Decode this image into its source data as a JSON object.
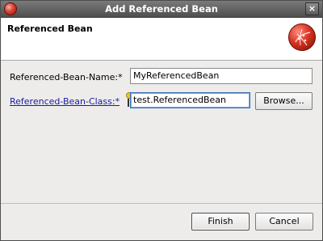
{
  "window": {
    "title": "Add Referenced Bean",
    "close_glyph": "×"
  },
  "banner": {
    "title": "Referenced Bean",
    "icon": "red-sphere-icon"
  },
  "form": {
    "name_label": "Referenced-Bean-Name:*",
    "name_value": "MyReferencedBean",
    "class_label": "Referenced-Bean-Class:*",
    "class_value": "test.ReferencedBean",
    "browse_label": "Browse..."
  },
  "buttons": {
    "finish": "Finish",
    "cancel": "Cancel"
  }
}
